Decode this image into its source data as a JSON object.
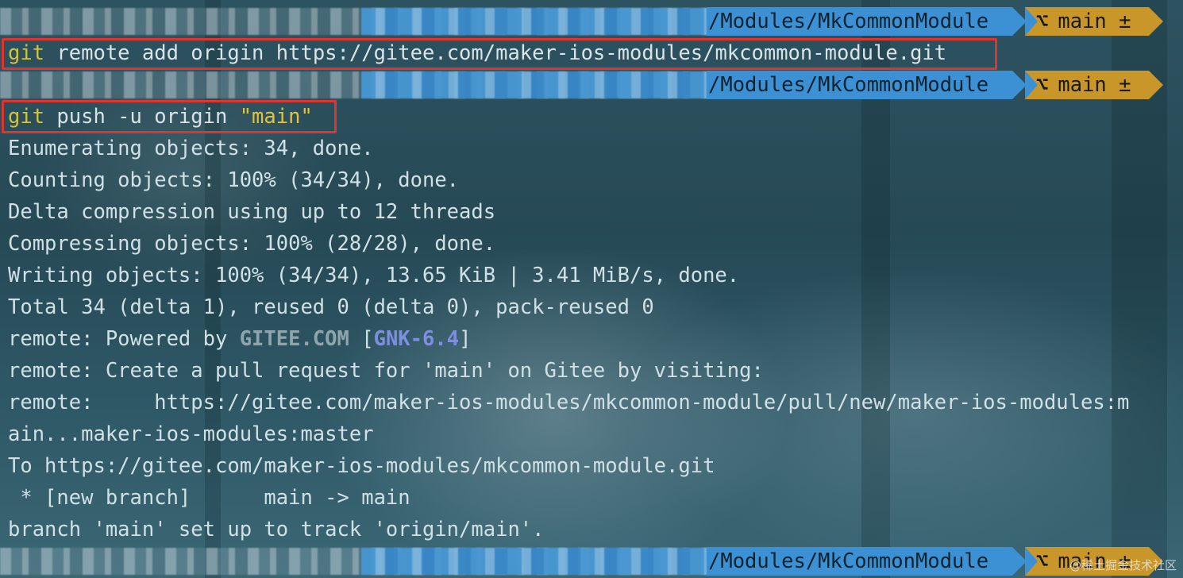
{
  "prompt": {
    "path": "/Modules/MkCommonModule",
    "branch_icon": "git-branch-icon",
    "branch": "main ±"
  },
  "commands": {
    "remote_add": {
      "git": "git",
      "rest": " remote add origin https://gitee.com/maker-ios-modules/mkcommon-module.git"
    },
    "push": {
      "git": "git",
      "rest": " push -u origin ",
      "arg": "\"main\""
    }
  },
  "output": {
    "l1": "Enumerating objects: 34, done.",
    "l2": "Counting objects: 100% (34/34), done.",
    "l3": "Delta compression using up to 12 threads",
    "l4": "Compressing objects: 100% (28/28), done.",
    "l5": "Writing objects: 100% (34/34), 13.65 KiB | 3.41 MiB/s, done.",
    "l6": "Total 34 (delta 1), reused 0 (delta 0), pack-reused 0",
    "l7_prefix": "remote: Powered by ",
    "l7_gitee": "GITEE.COM",
    "l7_mid": " [",
    "l7_gnk": "GNK-6.4",
    "l7_end": "]",
    "l8": "remote: Create a pull request for 'main' on Gitee by visiting:",
    "l9": "remote:     https://gitee.com/maker-ios-modules/mkcommon-module/pull/new/maker-ios-modules:m",
    "l10": "ain...maker-ios-modules:master",
    "l11": "To https://gitee.com/maker-ios-modules/mkcommon-module.git",
    "l12": " * [new branch]      main -> main",
    "l13": "branch 'main' set up to track 'origin/main'."
  },
  "watermark": "@稀土掘金技术社区",
  "colors": {
    "path_segment": "#3c90d4",
    "branch_segment": "#c9962a",
    "highlight_border": "#e0342e",
    "git_keyword": "#d3c23a"
  }
}
